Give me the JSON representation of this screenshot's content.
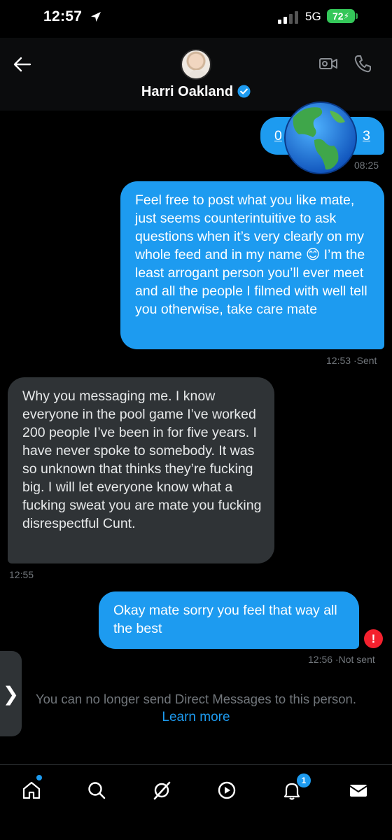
{
  "status": {
    "time": "12:57",
    "network": "5G",
    "battery": "72"
  },
  "header": {
    "contact_name": "Harri Oakland"
  },
  "messages": [
    {
      "side": "sent",
      "text_start": "0",
      "text_end": "3",
      "time": "08:25"
    },
    {
      "side": "sent",
      "text": "Feel free to post what you like mate, just seems counterintuitive to ask questions when it’s very clearly on my whole feed and in my name 😊 I’m the least arrogant person you’ll ever meet and all the people I filmed with well tell you otherwise, take care mate",
      "time": "12:53",
      "status": "Sent"
    },
    {
      "side": "received",
      "text": "Why you messaging me. I know everyone in the pool game I’ve worked 200 people I’ve been in for five years. I have never spoke to somebody. It was so unknown that thinks they’re fucking big. I will let everyone know what a fucking sweat you are mate you fucking disrespectful Cunt.",
      "time": "12:55"
    },
    {
      "side": "sent",
      "text": "Okay mate sorry you feel that way all the best",
      "time": "12:56",
      "status": "Not sent",
      "error_badge": "!"
    }
  ],
  "notice": {
    "text": "You can no longer send Direct Messages to this person.",
    "link": "Learn more"
  },
  "side_tab": {
    "glyph": "❯"
  },
  "bottom_nav": {
    "notification_count": "1"
  },
  "colors": {
    "accent": "#1d9bf0",
    "received_bubble": "#2f3336",
    "error": "#f4212e",
    "battery": "#34c759"
  }
}
